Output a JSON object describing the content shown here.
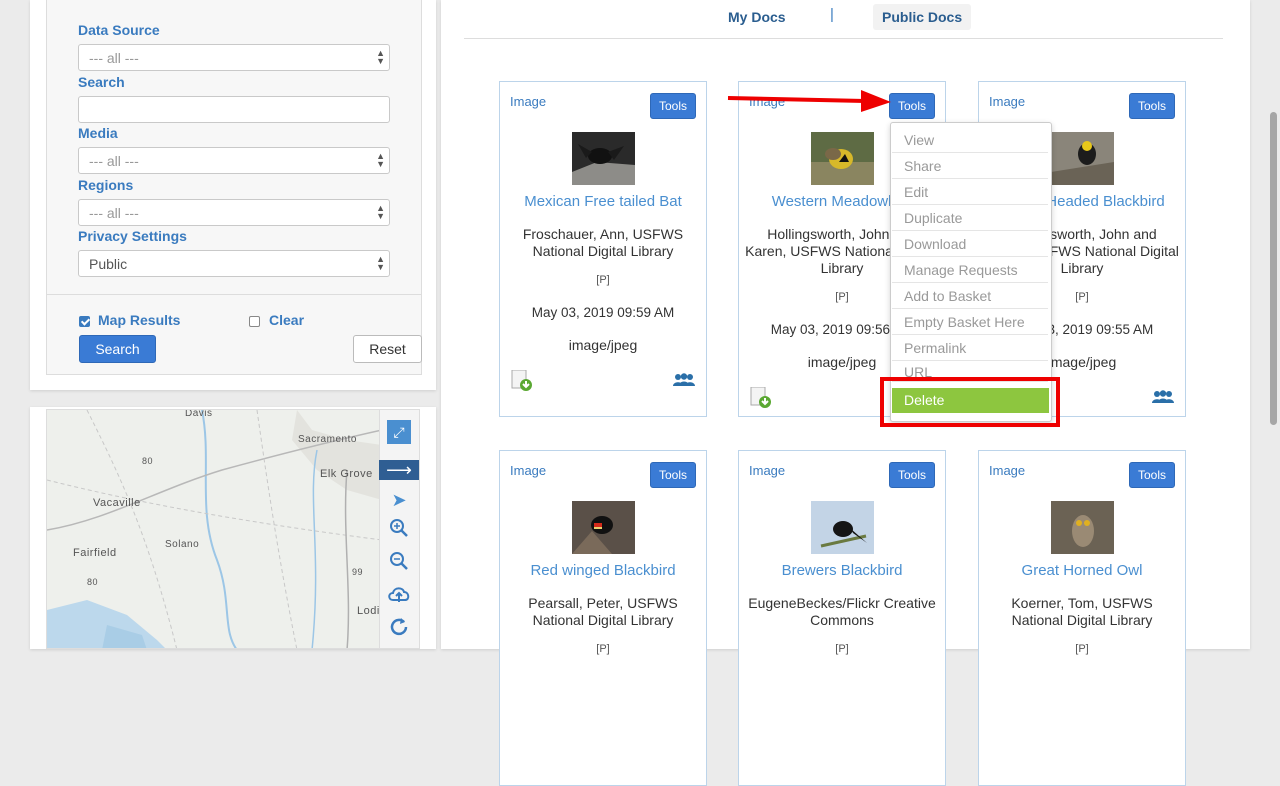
{
  "filters": {
    "data_source": {
      "label": "Data Source",
      "value": "--- all ---"
    },
    "search": {
      "label": "Search",
      "value": ""
    },
    "media": {
      "label": "Media",
      "value": "--- all ---"
    },
    "regions": {
      "label": "Regions",
      "value": "--- all ---"
    },
    "privacy": {
      "label": "Privacy Settings",
      "value": "Public"
    },
    "map_results": {
      "label": "Map Results",
      "checked": true
    },
    "clear": {
      "label": "Clear",
      "checked": false
    },
    "search_button": "Search",
    "reset_button": "Reset"
  },
  "map": {
    "places": [
      "Davis",
      "Sacramento",
      "Elk Grove",
      "Vacaville",
      "Solano",
      "Fairfield",
      "Lodi"
    ],
    "road_labels": [
      "80",
      "99",
      "80"
    ],
    "tools": [
      "expand-icon",
      "arrow-right-icon",
      "pointer-icon",
      "zoom-in-icon",
      "zoom-out-icon",
      "cloud-upload-icon",
      "refresh-icon"
    ]
  },
  "tabs": [
    {
      "label": "My Docs",
      "active": false
    },
    {
      "separator": "|"
    },
    {
      "label": "Public Docs",
      "active": true
    }
  ],
  "cards": [
    {
      "type": "Image",
      "tools": "Tools",
      "title": "Mexican Free tailed Bat",
      "author": "Froschauer, Ann, USFWS National Digital Library",
      "privacy": "[P]",
      "date": "May 03, 2019 09:59 AM",
      "mime": "image/jpeg"
    },
    {
      "type": "Image",
      "tools": "Tools",
      "title": "Western Meadowlark",
      "author": "Hollingsworth, John and Karen, USFWS National Digital Library",
      "privacy": "[P]",
      "date": "May 03, 2019 09:56 AM",
      "mime": "image/jpeg"
    },
    {
      "type": "Image",
      "tools": "Tools",
      "title": "Yellow Headed Blackbird",
      "author": "Hollingsworth, John and Karen, USFWS National Digital Library",
      "privacy": "[P]",
      "date": "May 03, 2019 09:55 AM",
      "mime": "image/jpeg"
    },
    {
      "type": "Image",
      "tools": "Tools",
      "title": "Red winged Blackbird",
      "author": "Pearsall, Peter, USFWS National Digital Library",
      "privacy": "[P]"
    },
    {
      "type": "Image",
      "tools": "Tools",
      "title": "Brewers Blackbird",
      "author": "EugeneBeckes/Flickr Creative Commons",
      "privacy": "[P]"
    },
    {
      "type": "Image",
      "tools": "Tools",
      "title": "Great Horned Owl",
      "author": "Koerner, Tom, USFWS National Digital Library",
      "privacy": "[P]"
    }
  ],
  "tools_menu": [
    "View",
    "Share",
    "Edit",
    "Duplicate",
    "Download",
    "Manage Requests",
    "Add to Basket",
    "Empty Basket Here",
    "Permalink",
    "URL",
    "Delete"
  ],
  "colors": {
    "accent": "#3a7bd5",
    "link": "#4a8fd0",
    "delete_bg": "#8dc63f",
    "annotation": "#ee0000"
  }
}
